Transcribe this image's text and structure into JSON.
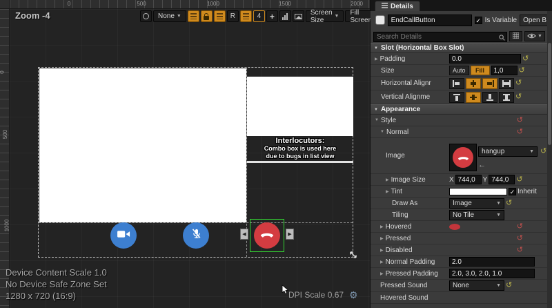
{
  "colors": {
    "accent_orange": "#cf8a1e",
    "selection_green": "#34d934",
    "button_blue": "#3d7fd0",
    "hangup_red": "#d43c41"
  },
  "canvas": {
    "zoom": "Zoom -4",
    "rulers": {
      "top": [
        "0",
        "500",
        "1000",
        "1500",
        "2000"
      ],
      "left": [
        "0",
        "500",
        "1000"
      ]
    },
    "toolbar": {
      "none": "None",
      "r": "R",
      "four": "4",
      "screen_size": "Screen Size",
      "fill_screen": "Fill Screen"
    },
    "preview": {
      "interlocutors_title": "Interlocutors:",
      "interlocutors_line1": "Combo box is used here",
      "interlocutors_line2": "due to bugs in list view"
    },
    "status": {
      "content_scale": "Device Content Scale 1.0",
      "safe_zone": "No Device Safe Zone Set",
      "resolution": "1280 x 720 (16:9)",
      "dpi_scale": "DPI Scale 0.67"
    }
  },
  "details": {
    "tab": "Details",
    "name_value": "EndCallButton",
    "is_variable": "Is Variable",
    "open_binding": "Open B",
    "search_placeholder": "Search Details",
    "slot": {
      "title": "Slot (Horizontal Box Slot)",
      "padding_label": "Padding",
      "padding_value": "0.0",
      "size_label": "Size",
      "auto": "Auto",
      "fill": "Fill",
      "size_value": "1,0",
      "halign_label": "Horizontal Alignr",
      "valign_label": "Vertical Alignme"
    },
    "appearance": {
      "title": "Appearance",
      "style": "Style",
      "normal": "Normal",
      "image": "Image",
      "image_value": "hangup",
      "image_size": "Image Size",
      "x": "X",
      "x_value": "744,0",
      "y": "Y",
      "y_value": "744,0",
      "tint": "Tint",
      "inherit": "Inherit",
      "draw_as": "Draw As",
      "draw_as_value": "Image",
      "tiling": "Tiling",
      "tiling_value": "No Tile",
      "hovered": "Hovered",
      "pressed": "Pressed",
      "disabled": "Disabled",
      "normal_padding": "Normal Padding",
      "normal_padding_value": "2.0",
      "pressed_padding": "Pressed Padding",
      "pressed_padding_value": "2.0, 3.0, 2.0, 1.0",
      "pressed_sound": "Pressed Sound",
      "pressed_sound_value": "None",
      "hovered_sound": "Hovered Sound"
    }
  }
}
